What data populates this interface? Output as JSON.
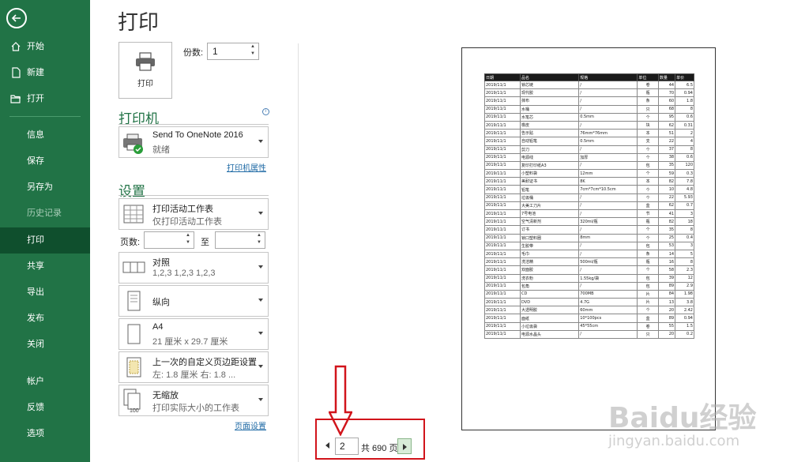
{
  "sidebar": {
    "items": [
      {
        "label": "开始",
        "icon": "home-icon"
      },
      {
        "label": "新建",
        "icon": "new-doc-icon"
      },
      {
        "label": "打开",
        "icon": "open-folder-icon"
      },
      {
        "label": "信息"
      },
      {
        "label": "保存"
      },
      {
        "label": "另存为"
      },
      {
        "label": "历史记录"
      },
      {
        "label": "打印"
      },
      {
        "label": "共享"
      },
      {
        "label": "导出"
      },
      {
        "label": "发布"
      },
      {
        "label": "关闭"
      },
      {
        "label": "帐户"
      },
      {
        "label": "反馈"
      },
      {
        "label": "选项"
      }
    ]
  },
  "print": {
    "title": "打印",
    "print_button": "打印",
    "copies_label": "份数:",
    "copies_value": "1",
    "printer_header": "打印机",
    "printer_name": "Send To OneNote 2016",
    "printer_status": "就绪",
    "printer_props": "打印机属性",
    "settings_header": "设置",
    "settings": [
      {
        "l1": "打印活动工作表",
        "l2": "仅打印活动工作表"
      },
      {
        "l1": "对照",
        "l2": "1,2,3    1,2,3    1,2,3"
      },
      {
        "l1": "纵向",
        "l2": ""
      },
      {
        "l1": "A4",
        "l2": "21 厘米 x 29.7 厘米"
      },
      {
        "l1": "上一次的自定义页边距设置",
        "l2": "左: 1.8 厘米    右: 1.8 ..."
      },
      {
        "l1": "无缩放",
        "l2": "打印实际大小的工作表"
      }
    ],
    "pages_label": "页数:",
    "to_label": "至",
    "page_setup": "页面设置"
  },
  "navigation": {
    "current_page": "2",
    "total_label": "共 690 页"
  },
  "watermark": {
    "text": "Baidu经验",
    "sub": "jingyan.baidu.com"
  },
  "sheet": {
    "headers": [
      "日期",
      "品名",
      "规格",
      "单位",
      "数量",
      "单价"
    ],
    "rows": [
      [
        "2019/11/1",
        "锁芯链",
        "/",
        "卷",
        "44",
        "6.5"
      ],
      [
        "2019/11/1",
        "现代胶",
        "/",
        "瓶",
        "70",
        "0.94"
      ],
      [
        "2019/11/1",
        "抹布",
        "/",
        "条",
        "60",
        "1.8"
      ],
      [
        "2019/11/1",
        "水桶",
        "/",
        "只",
        "68",
        "8"
      ],
      [
        "2019/11/1",
        "水笔芯",
        "0.5mm",
        "个",
        "95",
        "0.6"
      ],
      [
        "2019/11/1",
        "橡皮",
        "/",
        "块",
        "62",
        "0.31"
      ],
      [
        "2019/11/1",
        "告示贴",
        "76mm*76mm",
        "本",
        "51",
        "2"
      ],
      [
        "2019/11/1",
        "自动铅笔",
        "0.5mm",
        "支",
        "22",
        "4"
      ],
      [
        "2019/11/1",
        "剪刀",
        "/",
        "个",
        "37",
        "8"
      ],
      [
        "2019/11/1",
        "电源线",
        "加厚",
        "个",
        "38",
        "0.6"
      ],
      [
        "2019/11/1",
        "复印打印纸A3",
        "/",
        "包",
        "35",
        "120"
      ],
      [
        "2019/11/1",
        "小塑料袋",
        "12mm",
        "个",
        "59",
        "0.3"
      ],
      [
        "2019/11/1",
        "美耐证书",
        "8K",
        "本",
        "82",
        "7.8"
      ],
      [
        "2019/11/1",
        "铅笔",
        "7cm*7cm*10.5cm",
        "个",
        "10",
        "4.8"
      ],
      [
        "2019/11/1",
        "垃圾桶",
        "/",
        "个",
        "22",
        "5.93"
      ],
      [
        "2019/11/1",
        "大美工刀片",
        "/",
        "盒",
        "62",
        "0.7"
      ],
      [
        "2019/11/1",
        "7号电池",
        "/",
        "节",
        "41",
        "3"
      ],
      [
        "2019/11/1",
        "空气清新剂",
        "320ml/瓶",
        "瓶",
        "82",
        "18"
      ],
      [
        "2019/11/1",
        "订书",
        "/",
        "个",
        "35",
        "8"
      ],
      [
        "2019/11/1",
        "锁口塑料圈",
        "8mm",
        "个",
        "25",
        "0.4"
      ],
      [
        "2019/11/1",
        "生胶带",
        "/",
        "包",
        "53",
        "3"
      ],
      [
        "2019/11/1",
        "毛巾",
        "/",
        "条",
        "14",
        "5"
      ],
      [
        "2019/11/1",
        "洗洁精",
        "500ml/瓶",
        "瓶",
        "16",
        "8"
      ],
      [
        "2019/11/1",
        "双面胶",
        "/",
        "个",
        "58",
        "2.3"
      ],
      [
        "2019/11/1",
        "洗衣粉",
        "1.55kg/袋",
        "包",
        "39",
        "12"
      ],
      [
        "2019/11/1",
        "包角",
        "/",
        "包",
        "89",
        "2.9"
      ],
      [
        "2019/11/1",
        "CD",
        "700MB",
        "片",
        "84",
        "1.98"
      ],
      [
        "2019/11/1",
        "DVD",
        "4.7G",
        "片",
        "13",
        "3.8"
      ],
      [
        "2019/11/1",
        "大透明胶",
        "60mm",
        "个",
        "20",
        "2.42"
      ],
      [
        "2019/11/1",
        "面纸",
        "10*100pcs",
        "盒",
        "89",
        "0.94"
      ],
      [
        "2019/11/1",
        "小垃圾袋",
        "45*55cm",
        "卷",
        "55",
        "1.5"
      ],
      [
        "2019/11/1",
        "电源水晶头",
        "/",
        "只",
        "20",
        "0.2"
      ]
    ]
  }
}
